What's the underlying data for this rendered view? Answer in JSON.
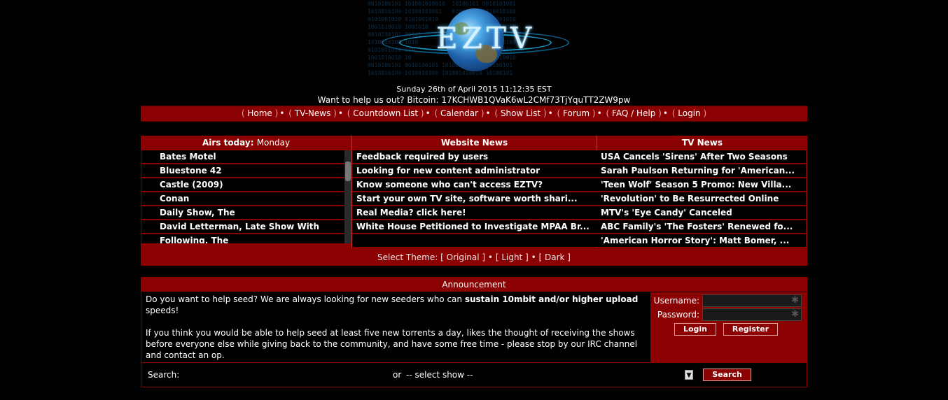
{
  "header": {
    "logo_text": "EZTV",
    "datetime": "Sunday 26th of April 2015 11:12:35 EST",
    "bitcoin": "Want to help us out? Bitcoin: 17KCHWB1QVaK6wL2CMf73TjYquTT2ZW9pw"
  },
  "nav": {
    "items": [
      "Home",
      "TV-News",
      "Countdown List",
      "Calendar",
      "Show List",
      "Forum",
      "FAQ / Help",
      "Login"
    ]
  },
  "airs_today": {
    "title": "Airs today:",
    "day": "Monday",
    "shows": [
      "Bates Motel",
      "Bluestone 42",
      "Castle (2009)",
      "Conan",
      "Daily Show, The",
      "David Letterman, Late Show With",
      "Following, The"
    ]
  },
  "website_news": {
    "title": "Website News",
    "items": [
      "Feedback required by users",
      "Looking for new content administrator",
      "Know someone who can't access EZTV?",
      "Start your own TV site, software worth shari...",
      "Real Media? click here!",
      "White House Petitioned to Investigate MPAA Br..."
    ]
  },
  "tv_news": {
    "title": "TV News",
    "items": [
      "USA Cancels 'Sirens' After Two Seasons",
      "Sarah Paulson Returning for 'American...",
      "'Teen Wolf' Season 5 Promo: New Villa...",
      "'Revolution' to Be Resurrected Online",
      "MTV's 'Eye Candy' Canceled",
      "ABC Family's 'The Fosters' Renewed fo...",
      "'American Horror Story': Matt Bomer, ..."
    ]
  },
  "theme": {
    "label": "Select Theme:",
    "options": [
      "Original",
      "Light",
      "Dark"
    ]
  },
  "announcement": {
    "title": "Announcement",
    "p1_a": "Do you want to help seed? We are always looking for new seeders who can ",
    "p1_bold": "sustain 10mbit and/or higher upload",
    "p1_b": " speeds!",
    "p2": "If you think you would be able to help seed at least five new torrents a day, likes the thought of receiving the shows before everyone else while giving back to the community, and have some free time - please stop by our IRC channel and contact an op."
  },
  "login": {
    "username_label": "Username:",
    "password_label": "Password:",
    "login_button": "Login",
    "register_button": "Register"
  },
  "search": {
    "label": "Search:",
    "or": "or",
    "select_value": "-- select show --",
    "button": "Search"
  },
  "colors": {
    "accent": "#8b0000",
    "background": "#000000",
    "text": "#ffffff"
  }
}
